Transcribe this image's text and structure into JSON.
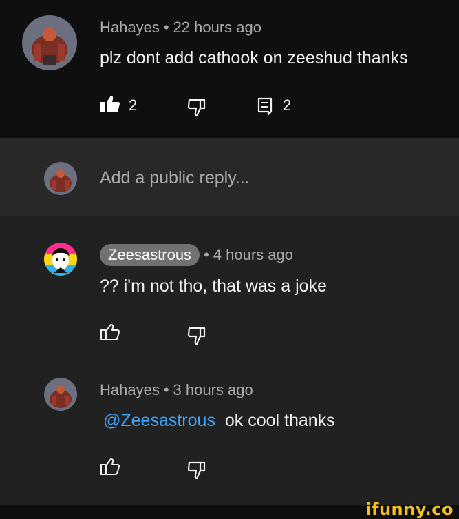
{
  "top_comment": {
    "author": "Hahayes",
    "time": "22 hours ago",
    "text": "plz dont add cathook on zeeshud thanks",
    "likes": "2",
    "replies": "2"
  },
  "reply_box": {
    "placeholder": "Add a public reply..."
  },
  "replies": [
    {
      "author": "Zeesastrous",
      "time": "4 hours ago",
      "text": "?? i'm not tho, that was a joke"
    },
    {
      "author": "Hahayes",
      "time": "3 hours ago",
      "mention": "@Zeesastrous",
      "text": "ok cool thanks"
    }
  ],
  "separator": "•",
  "watermark": "ifunny.co",
  "colors": {
    "mention": "#3ea6ff",
    "chip": "#717171",
    "meta": "#aaaaaa",
    "top_bg": "#0f0f0f",
    "reply_bar_bg": "#282828"
  }
}
